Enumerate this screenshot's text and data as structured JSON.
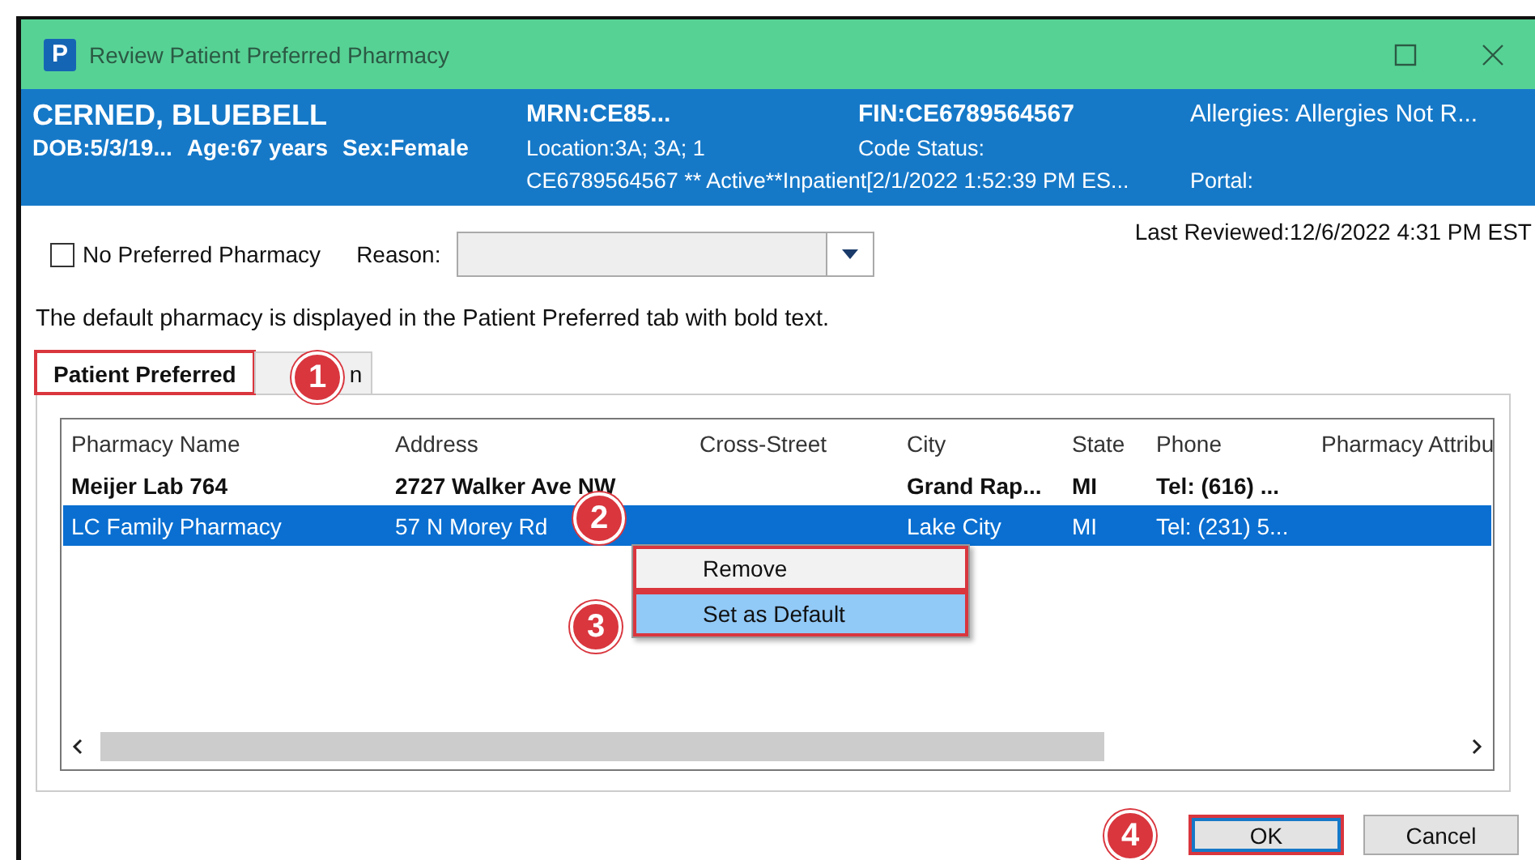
{
  "window": {
    "icon_letter": "P",
    "title": "Review Patient Preferred Pharmacy"
  },
  "banner": {
    "name": "CERNED, BLUEBELL",
    "dob": "DOB:5/3/19...",
    "age": "Age:67 years",
    "sex": "Sex:Female",
    "mrn": "MRN:CE85...",
    "location": "Location:3A; 3A; 1",
    "encounter": "CE6789564567 ** Active**Inpatient[2/1/2022 1:52:39 PM ES...",
    "fin": "FIN:CE6789564567",
    "code_status": "Code Status:",
    "allergies": "Allergies: Allergies Not R...",
    "portal": "Portal:"
  },
  "no_preferred": {
    "label": "No Preferred Pharmacy",
    "checked": false
  },
  "reason": {
    "label": "Reason:"
  },
  "last_reviewed": "Last Reviewed:12/6/2022 4:31 PM EST",
  "info": "The default pharmacy is displayed in the Patient Preferred tab with bold text.",
  "tabs": [
    {
      "label": "Patient Preferred",
      "selected": true,
      "outlined": true
    },
    {
      "label": "n",
      "selected": false,
      "outlined": false
    }
  ],
  "table": {
    "columns": [
      "Pharmacy Name",
      "Address",
      "Cross-Street",
      "City",
      "State",
      "Phone",
      "Pharmacy Attribu"
    ],
    "rows": [
      {
        "cells": [
          "Meijer Lab 764",
          "2727 Walker Ave NW",
          "",
          "Grand Rap...",
          "MI",
          "Tel: (616) ..."
        ],
        "default": true,
        "selected": false
      },
      {
        "cells": [
          "LC Family Pharmacy",
          "57 N Morey Rd",
          "",
          "Lake City",
          "MI",
          "Tel: (231) 5..."
        ],
        "default": false,
        "selected": true
      }
    ]
  },
  "context_menu": [
    {
      "label": "Remove",
      "selected": false,
      "outlined": true
    },
    {
      "label": "Set as Default",
      "selected": true,
      "outlined": true
    }
  ],
  "buttons": [
    {
      "label": "OK",
      "default": true,
      "outlined": true
    },
    {
      "label": "Cancel",
      "default": false,
      "outlined": false
    }
  ],
  "step_badges": [
    "1",
    "2",
    "3",
    "4"
  ]
}
